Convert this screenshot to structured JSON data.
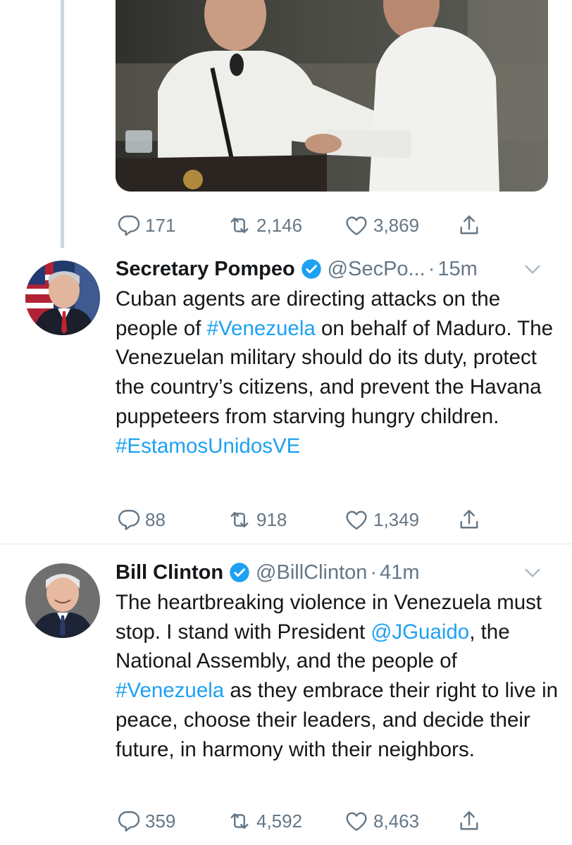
{
  "colors": {
    "link": "#1da1f2",
    "meta": "#657786",
    "text": "#14171a",
    "verified": "#1da1f2",
    "divider": "#e1e8ed"
  },
  "media": {
    "icon": "photo"
  },
  "tweet0": {
    "actions": {
      "replies": "171",
      "retweets": "2,146",
      "likes": "3,869"
    }
  },
  "tweet1": {
    "name": "Secretary Pompeo",
    "handle": "@SecPo...",
    "dot": "·",
    "time": "15m",
    "text": {
      "p1": "Cuban agents are directing attacks on the people of ",
      "tag1": "#Venezuela",
      "p2": " on behalf of Maduro. The Venezuelan military should do its duty, protect the country’s citizens, and prevent the Havana puppeteers from starving hungry children. ",
      "tag2": "#EstamosUnidosVE"
    },
    "actions": {
      "replies": "88",
      "retweets": "918",
      "likes": "1,349"
    }
  },
  "tweet2": {
    "name": "Bill Clinton",
    "handle": "@BillClinton",
    "dot": "·",
    "time": "41m",
    "text": {
      "p1": "The heartbreaking violence in Venezuela must stop. I stand with President ",
      "mention": "@JGuaido",
      "p2": ", the National Assembly, and the people of ",
      "tag1": "#Venezuela",
      "p3": " as they embrace their right to live in peace, choose their leaders, and decide their future, in harmony with their neighbors."
    },
    "actions": {
      "replies": "359",
      "retweets": "4,592",
      "likes": "8,463"
    }
  }
}
